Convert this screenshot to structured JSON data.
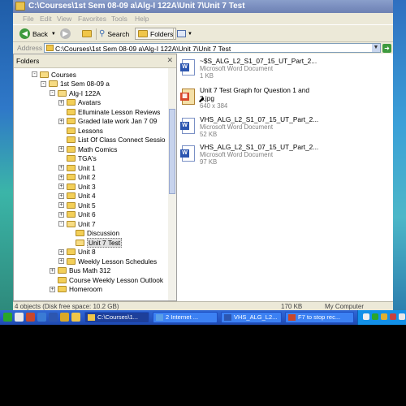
{
  "window": {
    "title": "C:\\Courses\\1st Sem 08-09 a\\Alg-I 122A\\Unit 7\\Unit 7 Test"
  },
  "menu": [
    "File",
    "Edit",
    "View",
    "Favorites",
    "Tools",
    "Help"
  ],
  "toolbar": {
    "back_label": "Back",
    "search_label": "Search",
    "folders_label": "Folders"
  },
  "address": {
    "label": "Address",
    "value": "C:\\Courses\\1st Sem 08-09 a\\Alg-I 122A\\Unit 7\\Unit 7 Test",
    "go_label": "Go"
  },
  "folders_pane": {
    "title": "Folders",
    "tree": [
      {
        "label": "Courses",
        "level": 0,
        "expander": "-"
      },
      {
        "label": "1st Sem 08-09 a",
        "level": 1,
        "expander": "-"
      },
      {
        "label": "Alg-I 122A",
        "level": 2,
        "expander": "-"
      },
      {
        "label": "Avatars",
        "level": 3,
        "expander": "+"
      },
      {
        "label": "Elluminate Lesson Reviews",
        "level": 3,
        "expander": ""
      },
      {
        "label": "Graded late work Jan 7 09",
        "level": 3,
        "expander": "+"
      },
      {
        "label": "Lessons",
        "level": 3,
        "expander": ""
      },
      {
        "label": "List Of Class Connect Sessio",
        "level": 3,
        "expander": ""
      },
      {
        "label": "Math Comics",
        "level": 3,
        "expander": "+"
      },
      {
        "label": "TGA's",
        "level": 3,
        "expander": ""
      },
      {
        "label": "Unit 1",
        "level": 3,
        "expander": "+"
      },
      {
        "label": "Unit 2",
        "level": 3,
        "expander": "+"
      },
      {
        "label": "Unit 3",
        "level": 3,
        "expander": "+"
      },
      {
        "label": "Unit 4",
        "level": 3,
        "expander": "+"
      },
      {
        "label": "Unit 5",
        "level": 3,
        "expander": "+"
      },
      {
        "label": "Unit 6",
        "level": 3,
        "expander": "+"
      },
      {
        "label": "Unit 7",
        "level": 3,
        "expander": "-"
      },
      {
        "label": "Discussion",
        "level": 4,
        "expander": ""
      },
      {
        "label": "Unit 7 Test",
        "level": 4,
        "expander": "",
        "selected": true
      },
      {
        "label": "Unit 8",
        "level": 3,
        "expander": "+"
      },
      {
        "label": "Weekly Lesson Schedules",
        "level": 3,
        "expander": "+"
      },
      {
        "label": "Bus Math 312",
        "level": 2,
        "expander": "+"
      },
      {
        "label": "Course Weekly Lesson Outlook",
        "level": 2,
        "expander": ""
      },
      {
        "label": "Homeroom",
        "level": 2,
        "expander": "+"
      }
    ]
  },
  "files": [
    {
      "name": "~$S_ALG_L2_S1_07_15_UT_Part_2...",
      "type": "Microsoft Word Document",
      "size": "1 KB",
      "kind": "doc"
    },
    {
      "name": "Unit 7 Test Graph for Question 1 and",
      "name2": "2.jpg",
      "type": "640 x 384",
      "kind": "jpg"
    },
    {
      "name": "VHS_ALG_L2_S1_07_15_UT_Part_2...",
      "type": "Microsoft Word Document",
      "size": "52 KB",
      "kind": "doc"
    },
    {
      "name": "VHS_ALG_L2_S1_07_15_UT_Part_2...",
      "type": "Microsoft Word Document",
      "size": "97 KB",
      "kind": "doc"
    }
  ],
  "status": {
    "left": "4 objects (Disk free space: 10.2 GB)",
    "size": "170 KB",
    "location": "My Computer"
  },
  "taskbar": {
    "items": [
      {
        "label": "C:\\Courses\\1...",
        "active": true
      },
      {
        "label": "2 Internet ...",
        "active": false
      },
      {
        "label": "VHS_ALG_L2...",
        "active": false
      },
      {
        "label": "F7 to stop rec...",
        "active": false
      }
    ]
  }
}
